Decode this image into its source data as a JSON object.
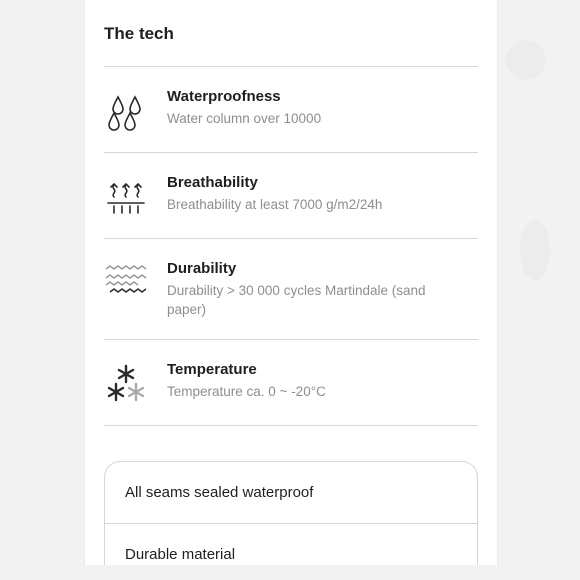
{
  "section": {
    "title": "The tech"
  },
  "tech_items": [
    {
      "icon": "water-drops-icon",
      "title": "Waterproofness",
      "description": "Water column over 10000"
    },
    {
      "icon": "breathability-arrows-icon",
      "title": "Breathability",
      "description": "Breathability at least 7000 g/m2/24h"
    },
    {
      "icon": "zigzag-durability-icon",
      "title": "Durability",
      "description": "Durability > 30 000 cycles Martindale (sand paper)"
    },
    {
      "icon": "snowflakes-icon",
      "title": "Temperature",
      "description": "Temperature ca. 0 ~ -20°C"
    }
  ],
  "features": [
    {
      "label": "All seams sealed waterproof"
    },
    {
      "label": "Durable material"
    }
  ]
}
